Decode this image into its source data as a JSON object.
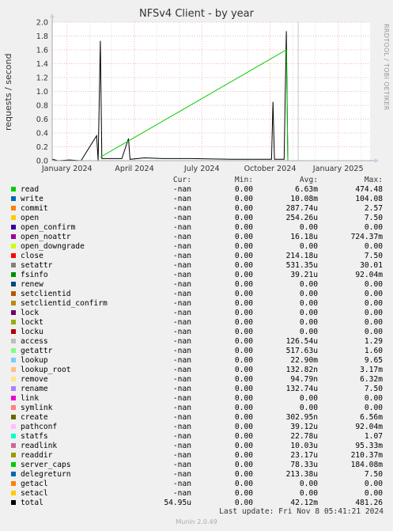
{
  "chart_data": {
    "type": "line",
    "title": "NFSv4 Client - by year",
    "ylabel": "requests / second",
    "xlabel": "",
    "ylim": [
      0,
      2.0
    ],
    "yticks": [
      "0.0",
      "0.2",
      "0.4",
      "0.6",
      "0.8",
      "1.0",
      "1.2",
      "1.4",
      "1.6",
      "1.8",
      "2.0"
    ],
    "xticks": [
      "January 2024",
      "April 2024",
      "July 2024",
      "October 2024",
      "January 2025"
    ],
    "grid": true,
    "series": [
      {
        "name": "total",
        "color": "#000000",
        "points": [
          [
            "2023-12-12",
            0.02
          ],
          [
            "2023-12-20",
            0.0
          ],
          [
            "2024-01-04",
            0.01
          ],
          [
            "2024-01-20",
            0.0
          ],
          [
            "2024-02-10",
            0.36
          ],
          [
            "2024-02-12",
            0.0
          ],
          [
            "2024-02-15",
            1.73
          ],
          [
            "2024-02-17",
            0.03
          ],
          [
            "2024-03-15",
            0.03
          ],
          [
            "2024-03-24",
            0.32
          ],
          [
            "2024-03-26",
            0.02
          ],
          [
            "2024-04-15",
            0.04
          ],
          [
            "2024-05-10",
            0.03
          ],
          [
            "2024-06-15",
            0.03
          ],
          [
            "2024-08-10",
            0.02
          ],
          [
            "2024-09-20",
            0.02
          ],
          [
            "2024-10-03",
            0.02
          ],
          [
            "2024-10-05",
            0.85
          ],
          [
            "2024-10-07",
            0.02
          ],
          [
            "2024-10-20",
            0.02
          ],
          [
            "2024-10-23",
            1.87
          ],
          [
            "2024-10-25",
            0.0
          ]
        ]
      },
      {
        "name": "read",
        "color": "#00cc00",
        "points": [
          [
            "2024-02-15",
            0.05
          ],
          [
            "2024-10-23",
            1.6
          ],
          [
            "2024-10-25",
            0.0
          ]
        ]
      }
    ]
  },
  "side_watermark": "RRDTOOL / TOBI OETIKER",
  "legend": {
    "header": {
      "cur": "Cur:",
      "min": "Min:",
      "avg": "Avg:",
      "max": "Max:"
    },
    "rows": [
      {
        "name": "read",
        "color": "#00cc00",
        "cur": "-nan",
        "min": "0.00",
        "avg": "6.63m",
        "max": "474.48"
      },
      {
        "name": "write",
        "color": "#0066b3",
        "cur": "-nan",
        "min": "0.00",
        "avg": "10.08m",
        "max": "104.08"
      },
      {
        "name": "commit",
        "color": "#ff8000",
        "cur": "-nan",
        "min": "0.00",
        "avg": "287.74u",
        "max": "2.57"
      },
      {
        "name": "open",
        "color": "#ffcc00",
        "cur": "-nan",
        "min": "0.00",
        "avg": "254.26u",
        "max": "7.50"
      },
      {
        "name": "open_confirm",
        "color": "#330099",
        "cur": "-nan",
        "min": "0.00",
        "avg": "0.00",
        "max": "0.00"
      },
      {
        "name": "open_noattr",
        "color": "#990099",
        "cur": "-nan",
        "min": "0.00",
        "avg": "16.18u",
        "max": "724.37m"
      },
      {
        "name": "open_downgrade",
        "color": "#ccff00",
        "cur": "-nan",
        "min": "0.00",
        "avg": "0.00",
        "max": "0.00"
      },
      {
        "name": "close",
        "color": "#ff0000",
        "cur": "-nan",
        "min": "0.00",
        "avg": "214.18u",
        "max": "7.50"
      },
      {
        "name": "setattr",
        "color": "#808080",
        "cur": "-nan",
        "min": "0.00",
        "avg": "531.35u",
        "max": "30.01"
      },
      {
        "name": "fsinfo",
        "color": "#008f00",
        "cur": "-nan",
        "min": "0.00",
        "avg": "39.21u",
        "max": "92.04m"
      },
      {
        "name": "renew",
        "color": "#00487d",
        "cur": "-nan",
        "min": "0.00",
        "avg": "0.00",
        "max": "0.00"
      },
      {
        "name": "setclientid",
        "color": "#b35a00",
        "cur": "-nan",
        "min": "0.00",
        "avg": "0.00",
        "max": "0.00"
      },
      {
        "name": "setclientid_confirm",
        "color": "#b38f00",
        "cur": "-nan",
        "min": "0.00",
        "avg": "0.00",
        "max": "0.00"
      },
      {
        "name": "lock",
        "color": "#6b006b",
        "cur": "-nan",
        "min": "0.00",
        "avg": "0.00",
        "max": "0.00"
      },
      {
        "name": "lockt",
        "color": "#8fb300",
        "cur": "-nan",
        "min": "0.00",
        "avg": "0.00",
        "max": "0.00"
      },
      {
        "name": "locku",
        "color": "#b30000",
        "cur": "-nan",
        "min": "0.00",
        "avg": "0.00",
        "max": "0.00"
      },
      {
        "name": "access",
        "color": "#bebebe",
        "cur": "-nan",
        "min": "0.00",
        "avg": "126.54u",
        "max": "1.29"
      },
      {
        "name": "getattr",
        "color": "#80ff80",
        "cur": "-nan",
        "min": "0.00",
        "avg": "517.63u",
        "max": "1.60"
      },
      {
        "name": "lookup",
        "color": "#80c9ff",
        "cur": "-nan",
        "min": "0.00",
        "avg": "22.90m",
        "max": "9.65"
      },
      {
        "name": "lookup_root",
        "color": "#ffc080",
        "cur": "-nan",
        "min": "0.00",
        "avg": "132.82n",
        "max": "3.17m"
      },
      {
        "name": "remove",
        "color": "#ffe680",
        "cur": "-nan",
        "min": "0.00",
        "avg": "94.79n",
        "max": "6.32m"
      },
      {
        "name": "rename",
        "color": "#aa80ff",
        "cur": "-nan",
        "min": "0.00",
        "avg": "132.74u",
        "max": "7.50"
      },
      {
        "name": "link",
        "color": "#ee00cc",
        "cur": "-nan",
        "min": "0.00",
        "avg": "0.00",
        "max": "0.00"
      },
      {
        "name": "symlink",
        "color": "#ff8080",
        "cur": "-nan",
        "min": "0.00",
        "avg": "0.00",
        "max": "0.00"
      },
      {
        "name": "create",
        "color": "#666600",
        "cur": "-nan",
        "min": "0.00",
        "avg": "302.95n",
        "max": "6.56m"
      },
      {
        "name": "pathconf",
        "color": "#ffbfff",
        "cur": "-nan",
        "min": "0.00",
        "avg": "39.12u",
        "max": "92.04m"
      },
      {
        "name": "statfs",
        "color": "#00ffcc",
        "cur": "-nan",
        "min": "0.00",
        "avg": "22.78u",
        "max": "1.07"
      },
      {
        "name": "readlink",
        "color": "#cc6699",
        "cur": "-nan",
        "min": "0.00",
        "avg": "10.03u",
        "max": "95.33m"
      },
      {
        "name": "readdir",
        "color": "#999900",
        "cur": "-nan",
        "min": "0.00",
        "avg": "23.17u",
        "max": "210.37m"
      },
      {
        "name": "server_caps",
        "color": "#00cc00",
        "cur": "-nan",
        "min": "0.00",
        "avg": "78.33u",
        "max": "184.08m"
      },
      {
        "name": "delegreturn",
        "color": "#0066b3",
        "cur": "-nan",
        "min": "0.00",
        "avg": "213.38u",
        "max": "7.50"
      },
      {
        "name": "getacl",
        "color": "#ff8000",
        "cur": "-nan",
        "min": "0.00",
        "avg": "0.00",
        "max": "0.00"
      },
      {
        "name": "setacl",
        "color": "#ffcc00",
        "cur": "-nan",
        "min": "0.00",
        "avg": "0.00",
        "max": "0.00"
      },
      {
        "name": "total",
        "color": "#000000",
        "cur": "54.95u",
        "min": "0.00",
        "avg": "42.12m",
        "max": "481.26"
      }
    ]
  },
  "last_update": "Last update: Fri Nov  8 05:41:21 2024",
  "footer": "Munin 2.0.49"
}
